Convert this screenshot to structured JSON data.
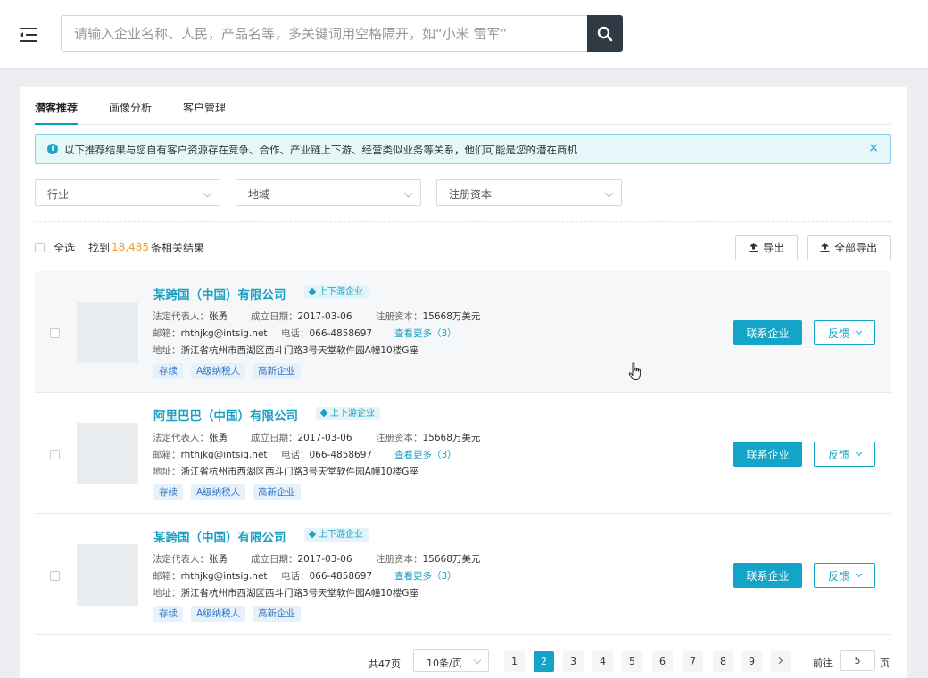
{
  "search": {
    "placeholder": "请输入企业名称、人民，产品名等，多关键词用空格隔开，如“小米 雷军”"
  },
  "tabs": [
    {
      "label": "潜客推荐",
      "active": true
    },
    {
      "label": "画像分析",
      "active": false
    },
    {
      "label": "客户管理",
      "active": false
    }
  ],
  "alert": {
    "text": "以下推荐结果与您自有客户资源存在竞争、合作、产业链上下游、经营类似业务等关系，他们可能是您的潜在商机",
    "close": "×"
  },
  "filters": [
    {
      "label": "行业"
    },
    {
      "label": "地域"
    },
    {
      "label": "注册资本"
    }
  ],
  "summary": {
    "select_all": "全选",
    "found_prefix": "找到",
    "count": "18,485",
    "found_suffix": "条相关结果"
  },
  "actions": {
    "export": "导出",
    "export_all": "全部导出"
  },
  "results": [
    {
      "name": "某跨国（中国）有限公司",
      "badge": "上下游企业",
      "legal_rep_label": "法定代表人：",
      "legal_rep": "张勇",
      "founded_label": "成立日期：",
      "founded": "2017-03-06",
      "capital_label": "注册资本：",
      "capital": "15668万美元",
      "email_label": "邮箱：",
      "email": "rhthjkg@intsig.net",
      "phone_label": "电话：",
      "phone": "066-4858697",
      "more": "查看更多（3）",
      "address_label": "地址：",
      "address": "浙江省杭州市西湖区西斗门路3号天堂软件园A幢10楼G座",
      "tags": [
        "存续",
        "A级纳税人",
        "高新企业"
      ],
      "contact": "联系企业",
      "feedback": "反馈"
    },
    {
      "name": "阿里巴巴（中国）有限公司",
      "badge": "上下游企业",
      "legal_rep_label": "法定代表人：",
      "legal_rep": "张勇",
      "founded_label": "成立日期：",
      "founded": "2017-03-06",
      "capital_label": "注册资本：",
      "capital": "15668万美元",
      "email_label": "邮箱：",
      "email": "rhthjkg@intsig.net",
      "phone_label": "电话：",
      "phone": "066-4858697",
      "more": "查看更多（3）",
      "address_label": "地址：",
      "address": "浙江省杭州市西湖区西斗门路3号天堂软件园A幢10楼G座",
      "tags": [
        "存续",
        "A级纳税人",
        "高新企业"
      ],
      "contact": "联系企业",
      "feedback": "反馈"
    },
    {
      "name": "某跨国（中国）有限公司",
      "badge": "上下游企业",
      "legal_rep_label": "法定代表人：",
      "legal_rep": "张勇",
      "founded_label": "成立日期：",
      "founded": "2017-03-06",
      "capital_label": "注册资本：",
      "capital": "15668万美元",
      "email_label": "邮箱：",
      "email": "rhthjkg@intsig.net",
      "phone_label": "电话：",
      "phone": "066-4858697",
      "more": "查看更多（3）",
      "address_label": "地址：",
      "address": "浙江省杭州市西湖区西斗门路3号天堂软件园A幢10楼G座",
      "tags": [
        "存续",
        "A级纳税人",
        "高新企业"
      ],
      "contact": "联系企业",
      "feedback": "反馈"
    }
  ],
  "pagination": {
    "total": "共47页",
    "page_size": "10条/页",
    "pages": [
      "1",
      "2",
      "3",
      "4",
      "5",
      "6",
      "7",
      "8",
      "9"
    ],
    "current": "2",
    "goto_label": "前往",
    "goto_value": "5",
    "page_suffix": "页"
  },
  "colors": {
    "accent": "#14a4c8",
    "search_button": "#2f3a44",
    "count_highlight": "#f39a1e",
    "tag_bg": "#e6f1fb",
    "tag_text": "#3577c2"
  },
  "icons": [
    "menu-icon",
    "search-icon",
    "info-icon",
    "close-icon",
    "upload-icon",
    "chevron-down-icon",
    "chevron-right-icon",
    "pointer-cursor-icon"
  ]
}
